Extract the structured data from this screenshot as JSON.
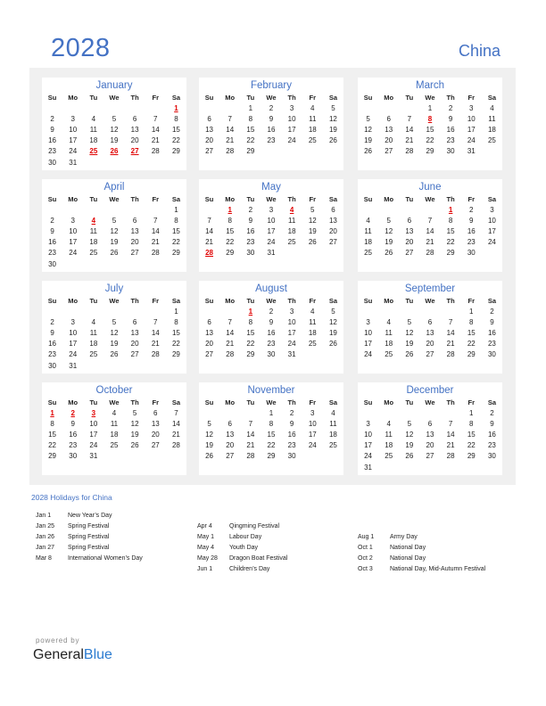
{
  "header": {
    "year": "2028",
    "country": "China"
  },
  "weekdays": [
    "Su",
    "Mo",
    "Tu",
    "We",
    "Th",
    "Fr",
    "Sa"
  ],
  "months": [
    {
      "name": "January",
      "weeks": [
        [
          "",
          "",
          "",
          "",
          "",
          "",
          "1"
        ],
        [
          "2",
          "3",
          "4",
          "5",
          "6",
          "7",
          "8"
        ],
        [
          "9",
          "10",
          "11",
          "12",
          "13",
          "14",
          "15"
        ],
        [
          "16",
          "17",
          "18",
          "19",
          "20",
          "21",
          "22"
        ],
        [
          "23",
          "24",
          "25",
          "26",
          "27",
          "28",
          "29"
        ],
        [
          "30",
          "31",
          "",
          "",
          "",
          "",
          ""
        ]
      ],
      "holidays": [
        "1",
        "25",
        "26",
        "27"
      ]
    },
    {
      "name": "February",
      "weeks": [
        [
          "",
          "",
          "1",
          "2",
          "3",
          "4",
          "5"
        ],
        [
          "6",
          "7",
          "8",
          "9",
          "10",
          "11",
          "12"
        ],
        [
          "13",
          "14",
          "15",
          "16",
          "17",
          "18",
          "19"
        ],
        [
          "20",
          "21",
          "22",
          "23",
          "24",
          "25",
          "26"
        ],
        [
          "27",
          "28",
          "29",
          "",
          "",
          "",
          ""
        ]
      ],
      "holidays": []
    },
    {
      "name": "March",
      "weeks": [
        [
          "",
          "",
          "",
          "1",
          "2",
          "3",
          "4"
        ],
        [
          "5",
          "6",
          "7",
          "8",
          "9",
          "10",
          "11"
        ],
        [
          "12",
          "13",
          "14",
          "15",
          "16",
          "17",
          "18"
        ],
        [
          "19",
          "20",
          "21",
          "22",
          "23",
          "24",
          "25"
        ],
        [
          "26",
          "27",
          "28",
          "29",
          "30",
          "31",
          ""
        ]
      ],
      "holidays": [
        "8"
      ]
    },
    {
      "name": "April",
      "weeks": [
        [
          "",
          "",
          "",
          "",
          "",
          "",
          "1"
        ],
        [
          "2",
          "3",
          "4",
          "5",
          "6",
          "7",
          "8"
        ],
        [
          "9",
          "10",
          "11",
          "12",
          "13",
          "14",
          "15"
        ],
        [
          "16",
          "17",
          "18",
          "19",
          "20",
          "21",
          "22"
        ],
        [
          "23",
          "24",
          "25",
          "26",
          "27",
          "28",
          "29"
        ],
        [
          "30",
          "",
          "",
          "",
          "",
          "",
          ""
        ]
      ],
      "holidays": [
        "4"
      ]
    },
    {
      "name": "May",
      "weeks": [
        [
          "",
          "1",
          "2",
          "3",
          "4",
          "5",
          "6"
        ],
        [
          "7",
          "8",
          "9",
          "10",
          "11",
          "12",
          "13"
        ],
        [
          "14",
          "15",
          "16",
          "17",
          "18",
          "19",
          "20"
        ],
        [
          "21",
          "22",
          "23",
          "24",
          "25",
          "26",
          "27"
        ],
        [
          "28",
          "29",
          "30",
          "31",
          "",
          "",
          ""
        ]
      ],
      "holidays": [
        "1",
        "4",
        "28"
      ]
    },
    {
      "name": "June",
      "weeks": [
        [
          "",
          "",
          "",
          "",
          "1",
          "2",
          "3"
        ],
        [
          "4",
          "5",
          "6",
          "7",
          "8",
          "9",
          "10"
        ],
        [
          "11",
          "12",
          "13",
          "14",
          "15",
          "16",
          "17"
        ],
        [
          "18",
          "19",
          "20",
          "21",
          "22",
          "23",
          "24"
        ],
        [
          "25",
          "26",
          "27",
          "28",
          "29",
          "30",
          ""
        ]
      ],
      "holidays": [
        "1"
      ]
    },
    {
      "name": "July",
      "weeks": [
        [
          "",
          "",
          "",
          "",
          "",
          "",
          "1"
        ],
        [
          "2",
          "3",
          "4",
          "5",
          "6",
          "7",
          "8"
        ],
        [
          "9",
          "10",
          "11",
          "12",
          "13",
          "14",
          "15"
        ],
        [
          "16",
          "17",
          "18",
          "19",
          "20",
          "21",
          "22"
        ],
        [
          "23",
          "24",
          "25",
          "26",
          "27",
          "28",
          "29"
        ],
        [
          "30",
          "31",
          "",
          "",
          "",
          "",
          ""
        ]
      ],
      "holidays": []
    },
    {
      "name": "August",
      "weeks": [
        [
          "",
          "",
          "1",
          "2",
          "3",
          "4",
          "5"
        ],
        [
          "6",
          "7",
          "8",
          "9",
          "10",
          "11",
          "12"
        ],
        [
          "13",
          "14",
          "15",
          "16",
          "17",
          "18",
          "19"
        ],
        [
          "20",
          "21",
          "22",
          "23",
          "24",
          "25",
          "26"
        ],
        [
          "27",
          "28",
          "29",
          "30",
          "31",
          "",
          ""
        ]
      ],
      "holidays": [
        "1"
      ]
    },
    {
      "name": "September",
      "weeks": [
        [
          "",
          "",
          "",
          "",
          "",
          "1",
          "2"
        ],
        [
          "3",
          "4",
          "5",
          "6",
          "7",
          "8",
          "9"
        ],
        [
          "10",
          "11",
          "12",
          "13",
          "14",
          "15",
          "16"
        ],
        [
          "17",
          "18",
          "19",
          "20",
          "21",
          "22",
          "23"
        ],
        [
          "24",
          "25",
          "26",
          "27",
          "28",
          "29",
          "30"
        ]
      ],
      "holidays": []
    },
    {
      "name": "October",
      "weeks": [
        [
          "1",
          "2",
          "3",
          "4",
          "5",
          "6",
          "7"
        ],
        [
          "8",
          "9",
          "10",
          "11",
          "12",
          "13",
          "14"
        ],
        [
          "15",
          "16",
          "17",
          "18",
          "19",
          "20",
          "21"
        ],
        [
          "22",
          "23",
          "24",
          "25",
          "26",
          "27",
          "28"
        ],
        [
          "29",
          "30",
          "31",
          "",
          "",
          "",
          ""
        ]
      ],
      "holidays": [
        "1",
        "2",
        "3"
      ]
    },
    {
      "name": "November",
      "weeks": [
        [
          "",
          "",
          "",
          "1",
          "2",
          "3",
          "4"
        ],
        [
          "5",
          "6",
          "7",
          "8",
          "9",
          "10",
          "11"
        ],
        [
          "12",
          "13",
          "14",
          "15",
          "16",
          "17",
          "18"
        ],
        [
          "19",
          "20",
          "21",
          "22",
          "23",
          "24",
          "25"
        ],
        [
          "26",
          "27",
          "28",
          "29",
          "30",
          "",
          ""
        ]
      ],
      "holidays": []
    },
    {
      "name": "December",
      "weeks": [
        [
          "",
          "",
          "",
          "",
          "",
          "1",
          "2"
        ],
        [
          "3",
          "4",
          "5",
          "6",
          "7",
          "8",
          "9"
        ],
        [
          "10",
          "11",
          "12",
          "13",
          "14",
          "15",
          "16"
        ],
        [
          "17",
          "18",
          "19",
          "20",
          "21",
          "22",
          "23"
        ],
        [
          "24",
          "25",
          "26",
          "27",
          "28",
          "29",
          "30"
        ],
        [
          "31",
          "",
          "",
          "",
          "",
          "",
          ""
        ]
      ],
      "holidays": []
    }
  ],
  "holidays_section": {
    "title": "2028 Holidays for China",
    "columns": [
      [
        {
          "date": "Jan 1",
          "name": "New Year’s Day"
        },
        {
          "date": "Jan 25",
          "name": "Spring Festival"
        },
        {
          "date": "Jan 26",
          "name": "Spring Festival"
        },
        {
          "date": "Jan 27",
          "name": "Spring Festival"
        },
        {
          "date": "Mar 8",
          "name": "International Women’s Day"
        }
      ],
      [
        {
          "date": "Apr 4",
          "name": "Qingming Festival"
        },
        {
          "date": "May 1",
          "name": "Labour Day"
        },
        {
          "date": "May 4",
          "name": "Youth Day"
        },
        {
          "date": "May 28",
          "name": "Dragon Boat Festival"
        },
        {
          "date": "Jun 1",
          "name": "Children’s Day"
        }
      ],
      [
        {
          "date": "Aug 1",
          "name": "Army Day"
        },
        {
          "date": "Oct 1",
          "name": "National Day"
        },
        {
          "date": "Oct 2",
          "name": "National Day"
        },
        {
          "date": "Oct 3",
          "name": "National Day, Mid-Autumn Festival"
        }
      ]
    ]
  },
  "footer": {
    "powered_by": "powered by",
    "brand_part1": "General",
    "brand_part2": "Blue"
  },
  "colors": {
    "accent": "#4472c4",
    "holiday": "#e00000",
    "panel_bg": "#f0f0f0",
    "brand_blue": "#2b7bd0"
  }
}
